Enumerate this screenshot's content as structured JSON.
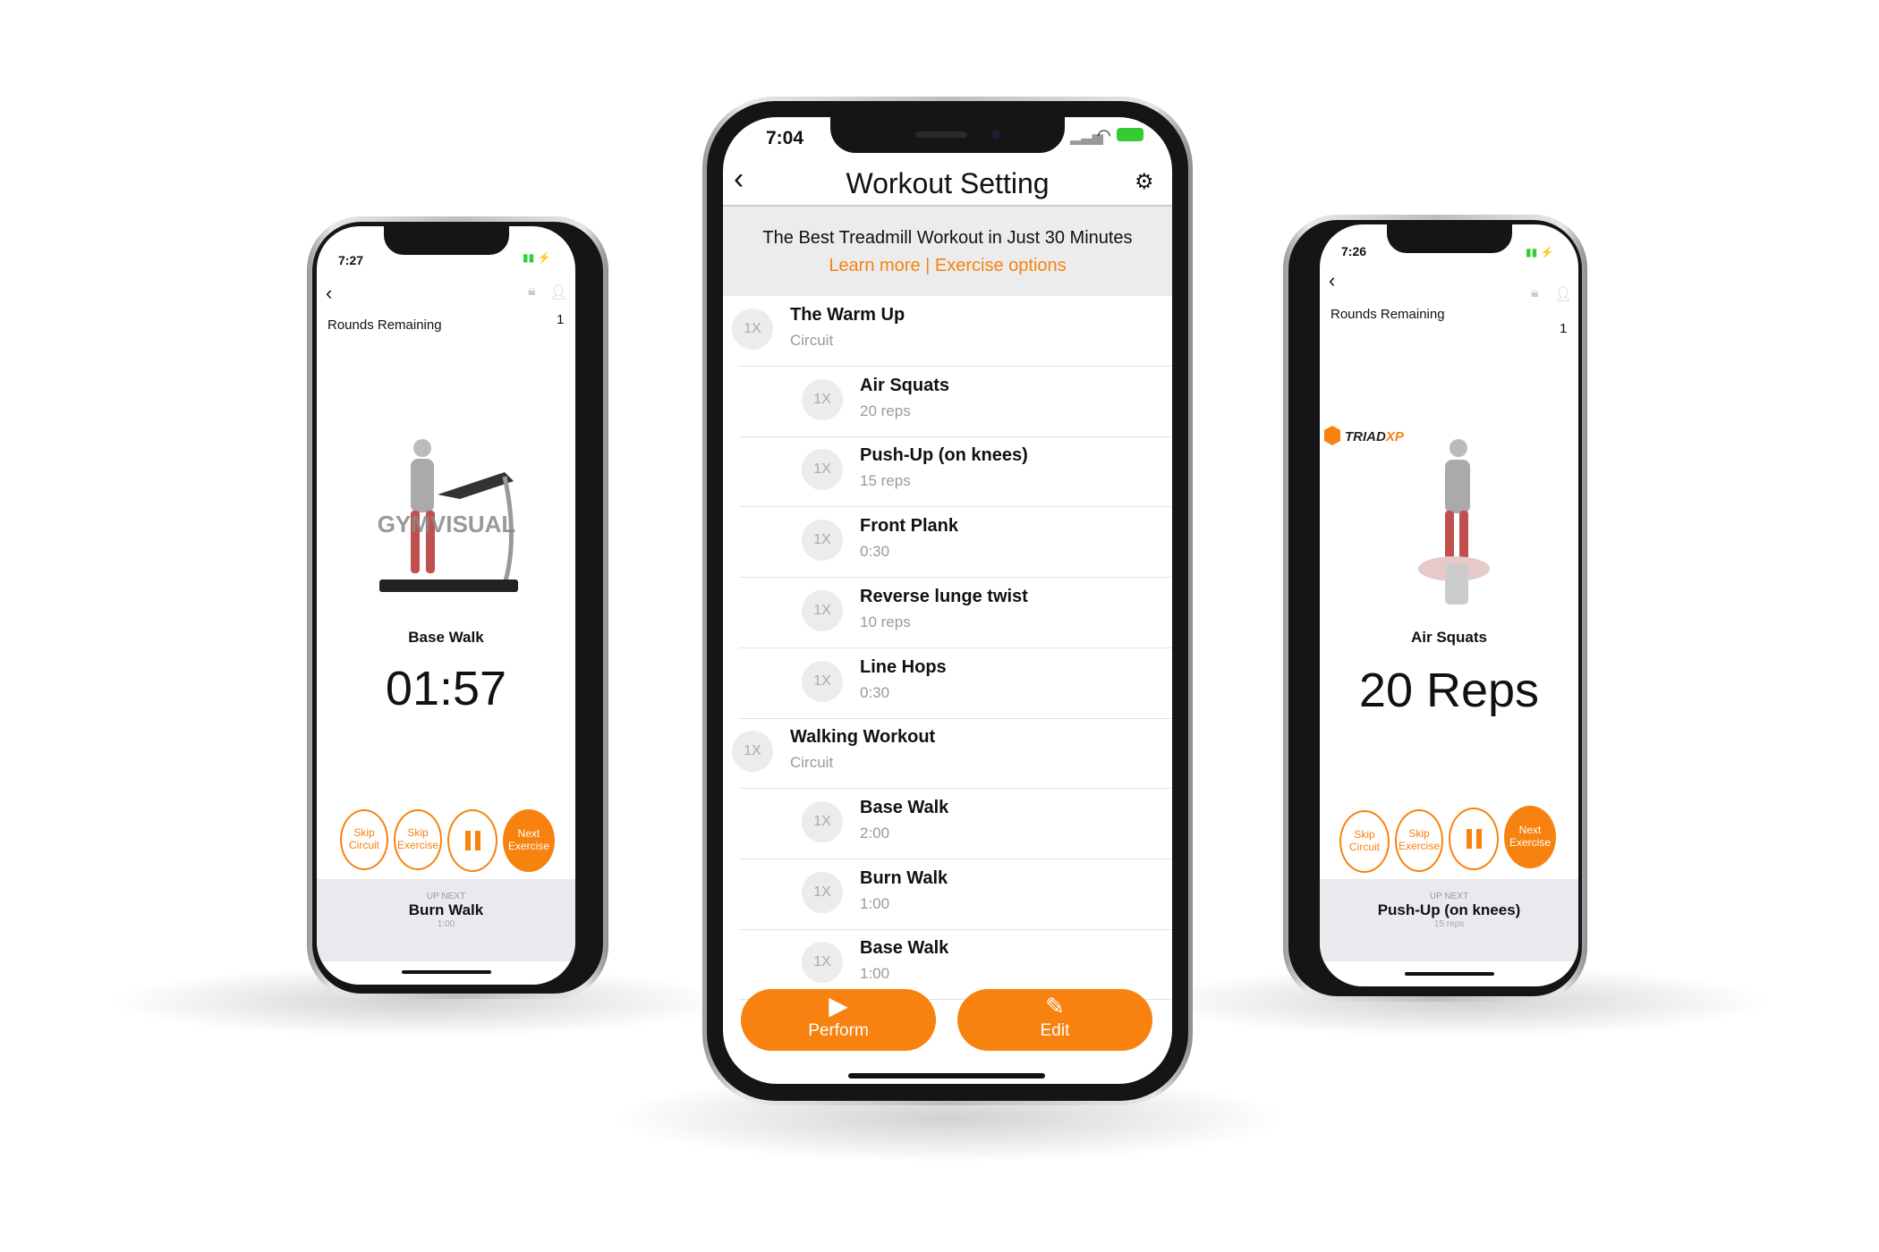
{
  "center_phone": {
    "status_time": "7:04",
    "header": {
      "title": "Workout Setting",
      "back_icon": "chevron-left-icon",
      "settings_icon": "gear-icon"
    },
    "banner": {
      "title": "The Best Treadmill Workout in Just 30 Minutes",
      "learn_more": "Learn more",
      "separator": "|",
      "exercise_options": "Exercise options"
    },
    "rows": [
      {
        "badge": "1X",
        "title": "The Warm Up",
        "sub": "Circuit",
        "type": "circuit"
      },
      {
        "badge": "1X",
        "title": "Air Squats",
        "sub": "20 reps",
        "type": "exercise"
      },
      {
        "badge": "1X",
        "title": "Push-Up (on knees)",
        "sub": "15 reps",
        "type": "exercise"
      },
      {
        "badge": "1X",
        "title": "Front Plank",
        "sub": "0:30",
        "type": "exercise"
      },
      {
        "badge": "1X",
        "title": "Reverse lunge twist",
        "sub": "10 reps",
        "type": "exercise"
      },
      {
        "badge": "1X",
        "title": "Line Hops",
        "sub": "0:30",
        "type": "exercise"
      },
      {
        "badge": "1X",
        "title": "Walking Workout",
        "sub": "Circuit",
        "type": "circuit"
      },
      {
        "badge": "1X",
        "title": "Base Walk",
        "sub": "2:00",
        "type": "exercise"
      },
      {
        "badge": "1X",
        "title": "Burn Walk",
        "sub": "1:00",
        "type": "exercise"
      },
      {
        "badge": "1X",
        "title": "Base Walk",
        "sub": "1:00",
        "type": "exercise"
      }
    ],
    "perform_label": "Perform",
    "edit_label": "Edit"
  },
  "left_phone": {
    "status_time": "7:27",
    "rounds_label": "Rounds Remaining",
    "rounds_value": "1",
    "image_watermark": "GYMVISUAL",
    "exercise_name": "Base Walk",
    "counter": "01:57",
    "buttons": {
      "skip_circuit": "Skip Circuit",
      "skip_exercise": "Skip Exercise",
      "next_exercise": "Next Exercise"
    },
    "up_next": {
      "label": "UP NEXT",
      "name": "Burn Walk",
      "detail": "1:00"
    }
  },
  "right_phone": {
    "status_time": "7:26",
    "rounds_label": "Rounds Remaining",
    "rounds_value": "1",
    "logo_text": "TRIADXP",
    "exercise_name": "Air Squats",
    "counter": "20 Reps",
    "buttons": {
      "skip_circuit": "Skip Circuit",
      "skip_exercise": "Skip Exercise",
      "next_exercise": "Next Exercise"
    },
    "up_next": {
      "label": "UP NEXT",
      "name": "Push-Up (on knees)",
      "detail": "15 reps"
    }
  },
  "colors": {
    "accent": "#f7820f",
    "banner_bg": "#ececec",
    "panel_bg": "#e9e9ee"
  }
}
